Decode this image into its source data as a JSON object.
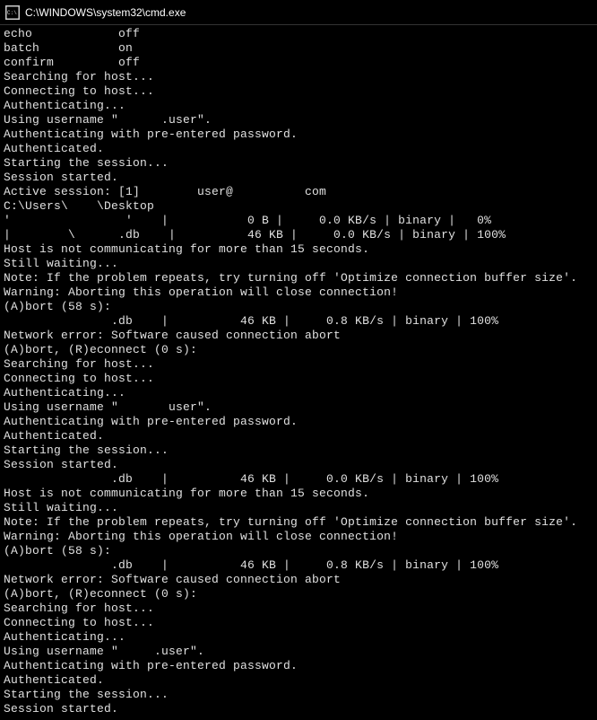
{
  "titlebar": {
    "icon_label": "C:\\",
    "title": "C:\\WINDOWS\\system32\\cmd.exe"
  },
  "terminal_lines": [
    "echo            off",
    "batch           on",
    "confirm         off",
    "Searching for host...",
    "Connecting to host...",
    "Authenticating...",
    "Using username \"      .user\".",
    "Authenticating with pre-entered password.",
    "Authenticated.",
    "Starting the session...",
    "Session started.",
    "Active session: [1]        user@          com",
    "C:\\Users\\    \\Desktop",
    "'                '    |           0 B |     0.0 KB/s | binary |   0%",
    "|        \\      .db    |          46 KB |     0.0 KB/s | binary | 100%",
    "Host is not communicating for more than 15 seconds.",
    "Still waiting...",
    "Note: If the problem repeats, try turning off 'Optimize connection buffer size'.",
    "Warning: Aborting this operation will close connection!",
    "(A)bort (58 s):",
    "               .db    |          46 KB |     0.8 KB/s | binary | 100%",
    "Network error: Software caused connection abort",
    "(A)bort, (R)econnect (0 s):",
    "Searching for host...",
    "Connecting to host...",
    "Authenticating...",
    "Using username \"       user\".",
    "Authenticating with pre-entered password.",
    "Authenticated.",
    "Starting the session...",
    "Session started.",
    "               .db    |          46 KB |     0.0 KB/s | binary | 100%",
    "Host is not communicating for more than 15 seconds.",
    "Still waiting...",
    "Note: If the problem repeats, try turning off 'Optimize connection buffer size'.",
    "Warning: Aborting this operation will close connection!",
    "(A)bort (58 s):",
    "               .db    |          46 KB |     0.8 KB/s | binary | 100%",
    "Network error: Software caused connection abort",
    "(A)bort, (R)econnect (0 s):",
    "Searching for host...",
    "Connecting to host...",
    "Authenticating...",
    "Using username \"     .user\".",
    "Authenticating with pre-entered password.",
    "Authenticated.",
    "Starting the session...",
    "Session started."
  ]
}
